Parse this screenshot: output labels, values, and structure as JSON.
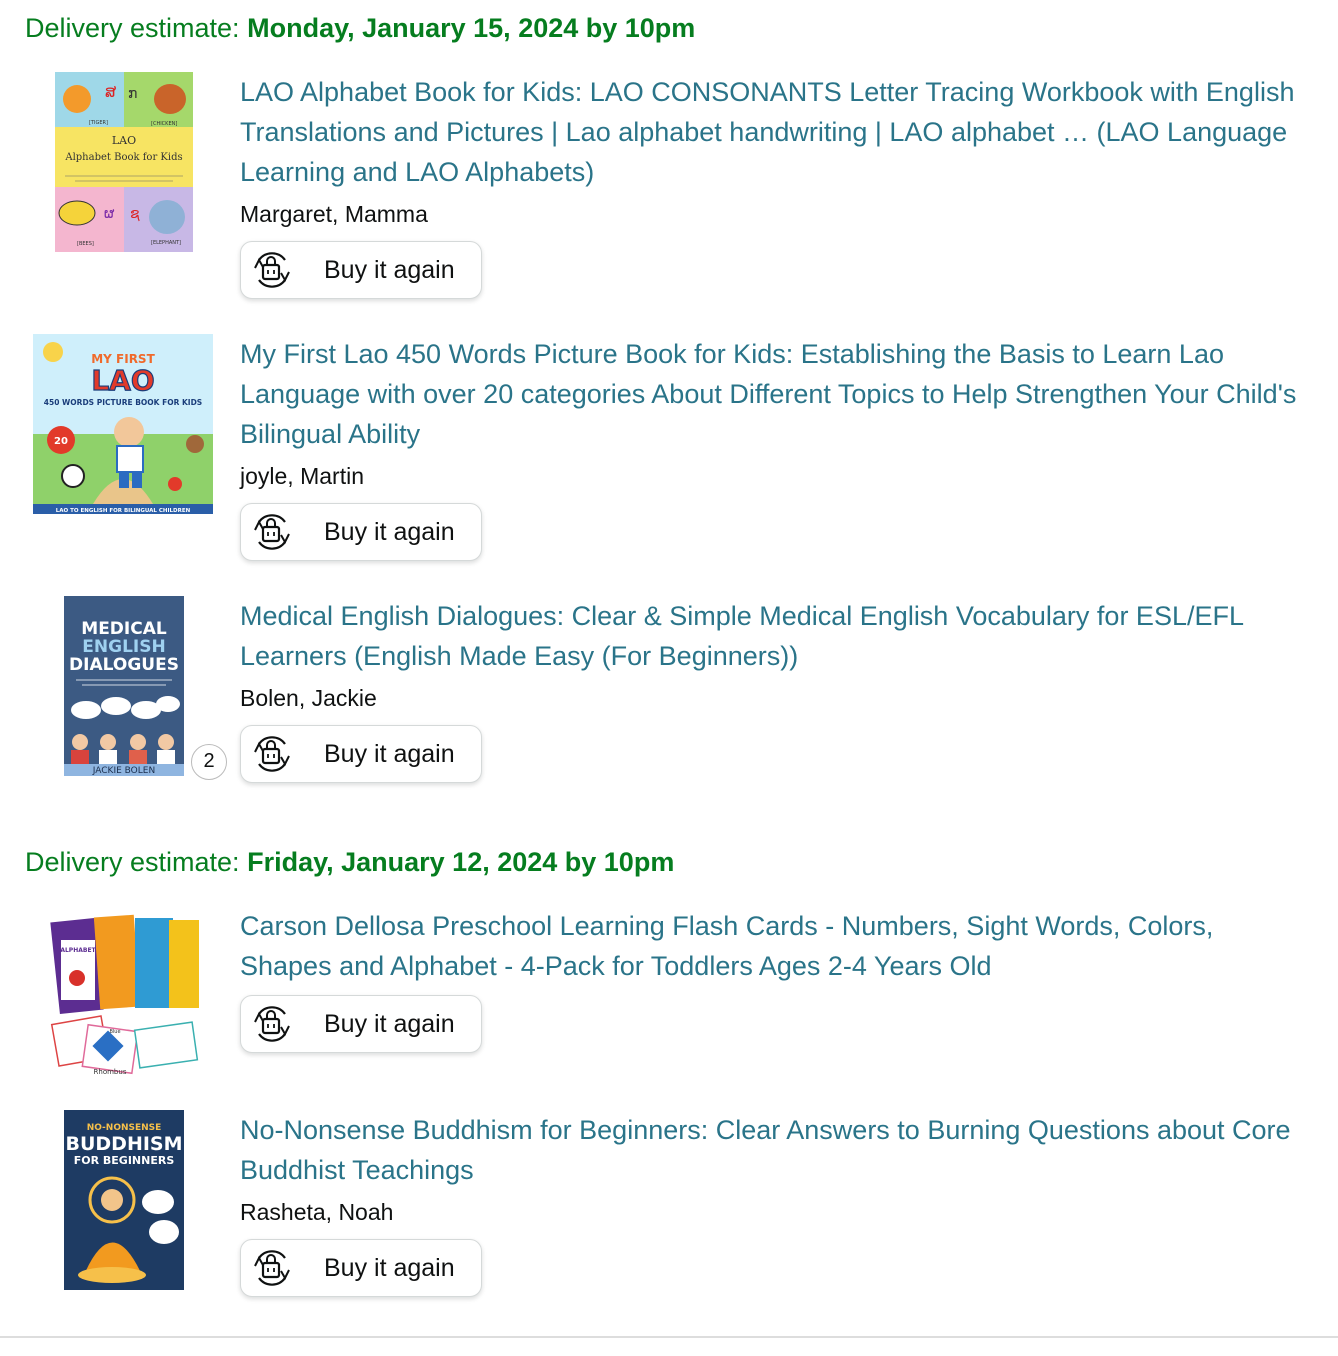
{
  "groups": [
    {
      "label": "Delivery estimate:",
      "date": "Monday, January 15, 2024 by 10pm",
      "items": [
        {
          "title": "LAO Alphabet Book for Kids: LAO CONSONANTS Letter Tracing Workbook with English Translations and Pictures | Lao alphabet handwriting | LAO alphabet … (LAO Language Learning and LAO Alphabets)",
          "author": "Margaret, Mamma",
          "button": "Buy it again",
          "cover": {
            "title": "LAO",
            "subtitle": "Alphabet Book for Kids",
            "label_tiger": "[TIGER]",
            "label_chicken": "[CHICKEN]",
            "label_bees": "[BEES]",
            "label_elephant": "[ELEPHANT]"
          }
        },
        {
          "title": "My First Lao 450 Words Picture Book for Kids: Establishing the Basis to Learn Lao Language with over 20 categories About Different Topics to Help Strengthen Your Child's Bilingual Ability",
          "author": "joyle, Martin",
          "button": "Buy it again",
          "cover": {
            "line1": "MY FIRST",
            "line2": "LAO",
            "line3": "450 WORDS PICTURE BOOK FOR KIDS",
            "badge": "20",
            "footer": "LAO TO ENGLISH FOR BILINGUAL CHILDREN"
          }
        },
        {
          "title": "Medical English Dialogues: Clear & Simple Medical English Vocabulary for ESL/EFL Learners (English Made Easy (For Beginners))",
          "author": "Bolen, Jackie",
          "button": "Buy it again",
          "quantity": "2",
          "cover": {
            "line1": "MEDICAL",
            "line2": "ENGLISH",
            "line3": "DIALOGUES",
            "footer": "JACKIE BOLEN"
          }
        }
      ]
    },
    {
      "label": "Delivery estimate:",
      "date": "Friday, January 12, 2024 by 10pm",
      "items": [
        {
          "title": "Carson Dellosa Preschool Learning Flash Cards - Numbers, Sight Words, Colors, Shapes and Alphabet - 4-Pack for Toddlers Ages 2-4 Years Old",
          "author": "",
          "button": "Buy it again",
          "cover": {
            "box": "ALPHABET",
            "card": "Rhombus",
            "card2": "Blue"
          }
        },
        {
          "title": "No-Nonsense Buddhism for Beginners: Clear Answers to Burning Questions about Core Buddhist Teachings",
          "author": "Rasheta, Noah",
          "button": "Buy it again",
          "cover": {
            "line1": "NO-NONSENSE",
            "line2": "BUDDHISM",
            "line3": "FOR BEGINNERS"
          }
        }
      ]
    }
  ],
  "colors": {
    "delivery_green": "#067d1f",
    "link_teal": "#2a7489",
    "text": "#0f1111"
  }
}
